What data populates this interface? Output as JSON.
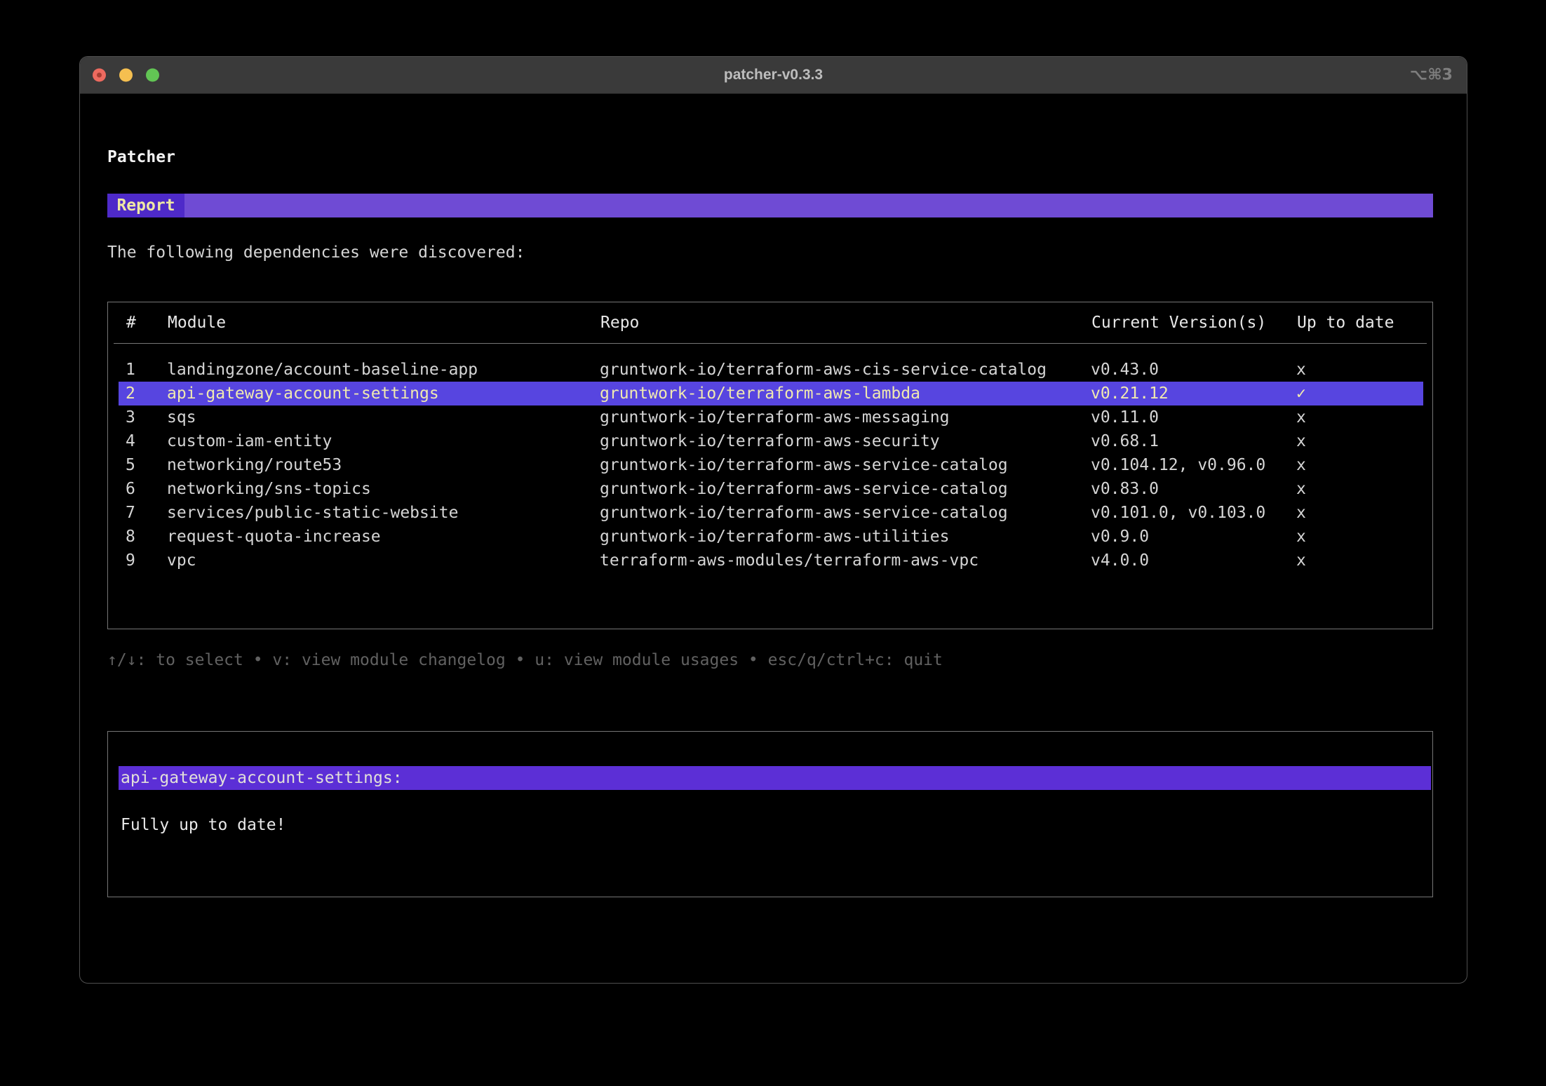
{
  "window": {
    "title": "patcher-v0.3.3",
    "shortcut": "⌥⌘3"
  },
  "app": {
    "heading": "Patcher",
    "tab_label": "Report",
    "intro": "The following dependencies were discovered:",
    "help": "↑/↓: to select • v: view module changelog • u: view module usages • esc/q/ctrl+c: quit"
  },
  "table": {
    "columns": [
      "#",
      "Module",
      "Repo",
      "Current Version(s)",
      "Up to date"
    ],
    "rows": [
      {
        "num": "1",
        "module": "landingzone/account-baseline-app",
        "repo": "gruntwork-io/terraform-aws-cis-service-catalog",
        "versions": "v0.43.0",
        "up_to_date": "x",
        "selected": false
      },
      {
        "num": "2",
        "module": "api-gateway-account-settings",
        "repo": "gruntwork-io/terraform-aws-lambda",
        "versions": "v0.21.12",
        "up_to_date": "✓",
        "selected": true
      },
      {
        "num": "3",
        "module": "sqs",
        "repo": "gruntwork-io/terraform-aws-messaging",
        "versions": "v0.11.0",
        "up_to_date": "x",
        "selected": false
      },
      {
        "num": "4",
        "module": "custom-iam-entity",
        "repo": "gruntwork-io/terraform-aws-security",
        "versions": "v0.68.1",
        "up_to_date": "x",
        "selected": false
      },
      {
        "num": "5",
        "module": "networking/route53",
        "repo": "gruntwork-io/terraform-aws-service-catalog",
        "versions": "v0.104.12, v0.96.0",
        "up_to_date": "x",
        "selected": false
      },
      {
        "num": "6",
        "module": "networking/sns-topics",
        "repo": "gruntwork-io/terraform-aws-service-catalog",
        "versions": "v0.83.0",
        "up_to_date": "x",
        "selected": false
      },
      {
        "num": "7",
        "module": "services/public-static-website",
        "repo": "gruntwork-io/terraform-aws-service-catalog",
        "versions": "v0.101.0, v0.103.0",
        "up_to_date": "x",
        "selected": false
      },
      {
        "num": "8",
        "module": "request-quota-increase",
        "repo": "gruntwork-io/terraform-aws-utilities",
        "versions": "v0.9.0",
        "up_to_date": "x",
        "selected": false
      },
      {
        "num": "9",
        "module": "vpc",
        "repo": "terraform-aws-modules/terraform-aws-vpc",
        "versions": "v4.0.0",
        "up_to_date": "x",
        "selected": false
      }
    ]
  },
  "detail": {
    "title": "api-gateway-account-settings:",
    "body": "Fully up to date!"
  },
  "colors": {
    "tab-bar-bg": "#6f4bd4",
    "tab-active-bg": "#4e2ac9",
    "tab-text": "#efe8a4",
    "selection-bg": "#5745e0",
    "selection-text": "#f0e9b0",
    "detail-band-bg": "#5c2fd6",
    "close-red": "#ed6a5f",
    "minimize-yellow": "#f5bf50",
    "zoom-green": "#62c554"
  }
}
